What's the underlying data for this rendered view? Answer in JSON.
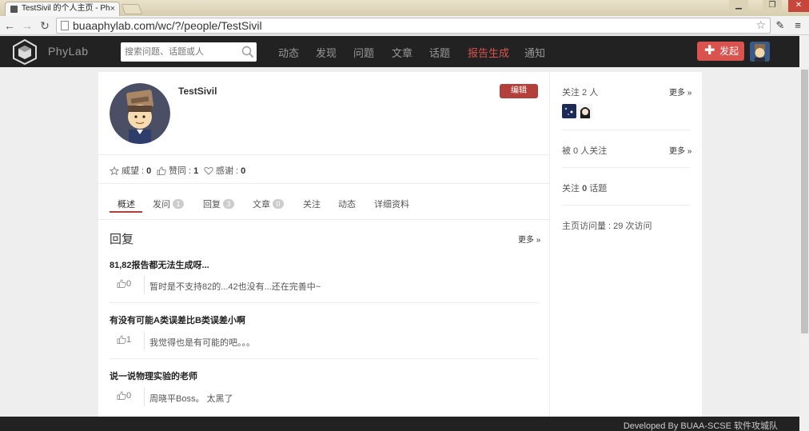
{
  "browser": {
    "tab_title": "TestSivil 的个人主页 - Ph",
    "url": "buaaphylab.com/wc/?/people/TestSivil",
    "minimize": "▁",
    "restore": "❐",
    "close": "✕"
  },
  "nav": {
    "logo": "PhyLab",
    "search_placeholder": "搜索问题、话题或人",
    "links": [
      "动态",
      "发现",
      "问题",
      "文章",
      "话题",
      "报告生成",
      "通知"
    ],
    "publish_label": "发起"
  },
  "profile": {
    "username": "TestSivil",
    "edit_label": "编辑",
    "stats": [
      {
        "label": "威望 : ",
        "value": "0",
        "icon": "prestige-icon"
      },
      {
        "label": "赞同 : ",
        "value": "1",
        "icon": "thumb-up-icon"
      },
      {
        "label": "感谢 : ",
        "value": "0",
        "icon": "heart-icon"
      }
    ],
    "tabs": [
      {
        "label": "概述",
        "badge": null
      },
      {
        "label": "发问",
        "badge": "1"
      },
      {
        "label": "回复",
        "badge": "3"
      },
      {
        "label": "文章",
        "badge": "0"
      },
      {
        "label": "关注",
        "badge": null
      },
      {
        "label": "动态",
        "badge": null
      },
      {
        "label": "详细资料",
        "badge": null
      }
    ]
  },
  "replies": {
    "title": "回复",
    "more": "更多 »",
    "items": [
      {
        "question": "81,82报告都无法生成呀...",
        "votes": "0",
        "answer": "暂时是不支持82的...42也没有...还在完善中~"
      },
      {
        "question": "有没有可能A类误差比B类误差小啊",
        "votes": "1",
        "answer": "我觉得也是有可能的吧。。。"
      },
      {
        "question": "说一说物理实验的老师",
        "votes": "0",
        "answer": "周晓平Boss。 太黑了"
      }
    ]
  },
  "sidebar": {
    "following": "关注 2 人",
    "followers": "被 0 人关注",
    "topics_prefix": "关注 ",
    "topics_count": "0",
    "topics_suffix": " 话题",
    "visits": "主页访问量 : 29 次访问",
    "more": "更多 »"
  },
  "footer": {
    "text": "Developed By BUAA-SCSE 软件攻城队"
  },
  "colors": {
    "brand_red": "#d9534f",
    "nav_bg": "#222222",
    "edit_red": "#b33f3b"
  }
}
